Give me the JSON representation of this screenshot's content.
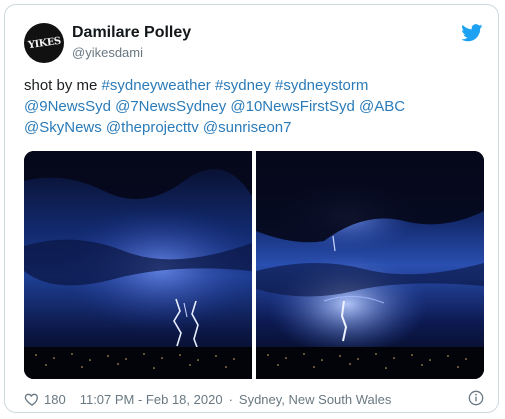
{
  "author": {
    "name": "Damilare Polley",
    "handle": "@yikesdami",
    "avatar_text": "YIKES"
  },
  "tweet": {
    "lines": [
      [
        {
          "text": "shot by me ",
          "type": "plain"
        },
        {
          "text": "#sydneyweather",
          "type": "link"
        },
        {
          "text": " ",
          "type": "plain"
        },
        {
          "text": "#sydney",
          "type": "link"
        },
        {
          "text": " ",
          "type": "plain"
        },
        {
          "text": "#sydneystorm",
          "type": "link"
        }
      ],
      [
        {
          "text": "@9NewsSyd",
          "type": "link"
        },
        {
          "text": " ",
          "type": "plain"
        },
        {
          "text": "@7NewsSydney",
          "type": "link"
        },
        {
          "text": " ",
          "type": "plain"
        },
        {
          "text": "@10NewsFirstSyd",
          "type": "link"
        },
        {
          "text": " ",
          "type": "plain"
        },
        {
          "text": "@ABC",
          "type": "link"
        }
      ],
      [
        {
          "text": "@SkyNews",
          "type": "link"
        },
        {
          "text": " ",
          "type": "plain"
        },
        {
          "text": "@theprojecttv",
          "type": "link"
        },
        {
          "text": " ",
          "type": "plain"
        },
        {
          "text": "@sunriseon7",
          "type": "link"
        }
      ]
    ],
    "media": [
      {
        "name": "lightning-photo-left",
        "description_icon": "photo"
      },
      {
        "name": "lightning-photo-right",
        "description_icon": "photo"
      }
    ]
  },
  "footer": {
    "likes": "180",
    "time": "11:07 PM - Feb 18, 2020",
    "separator": "·",
    "location": "Sydney, New South Wales"
  },
  "icons": {
    "brand": "twitter-bird-icon",
    "like": "heart-icon",
    "info": "info-icon"
  },
  "colors": {
    "link": "#2b7bb9",
    "brand": "#1da1f2",
    "muted": "#697882",
    "text": "#1c2022",
    "border": "#cfd9de"
  }
}
